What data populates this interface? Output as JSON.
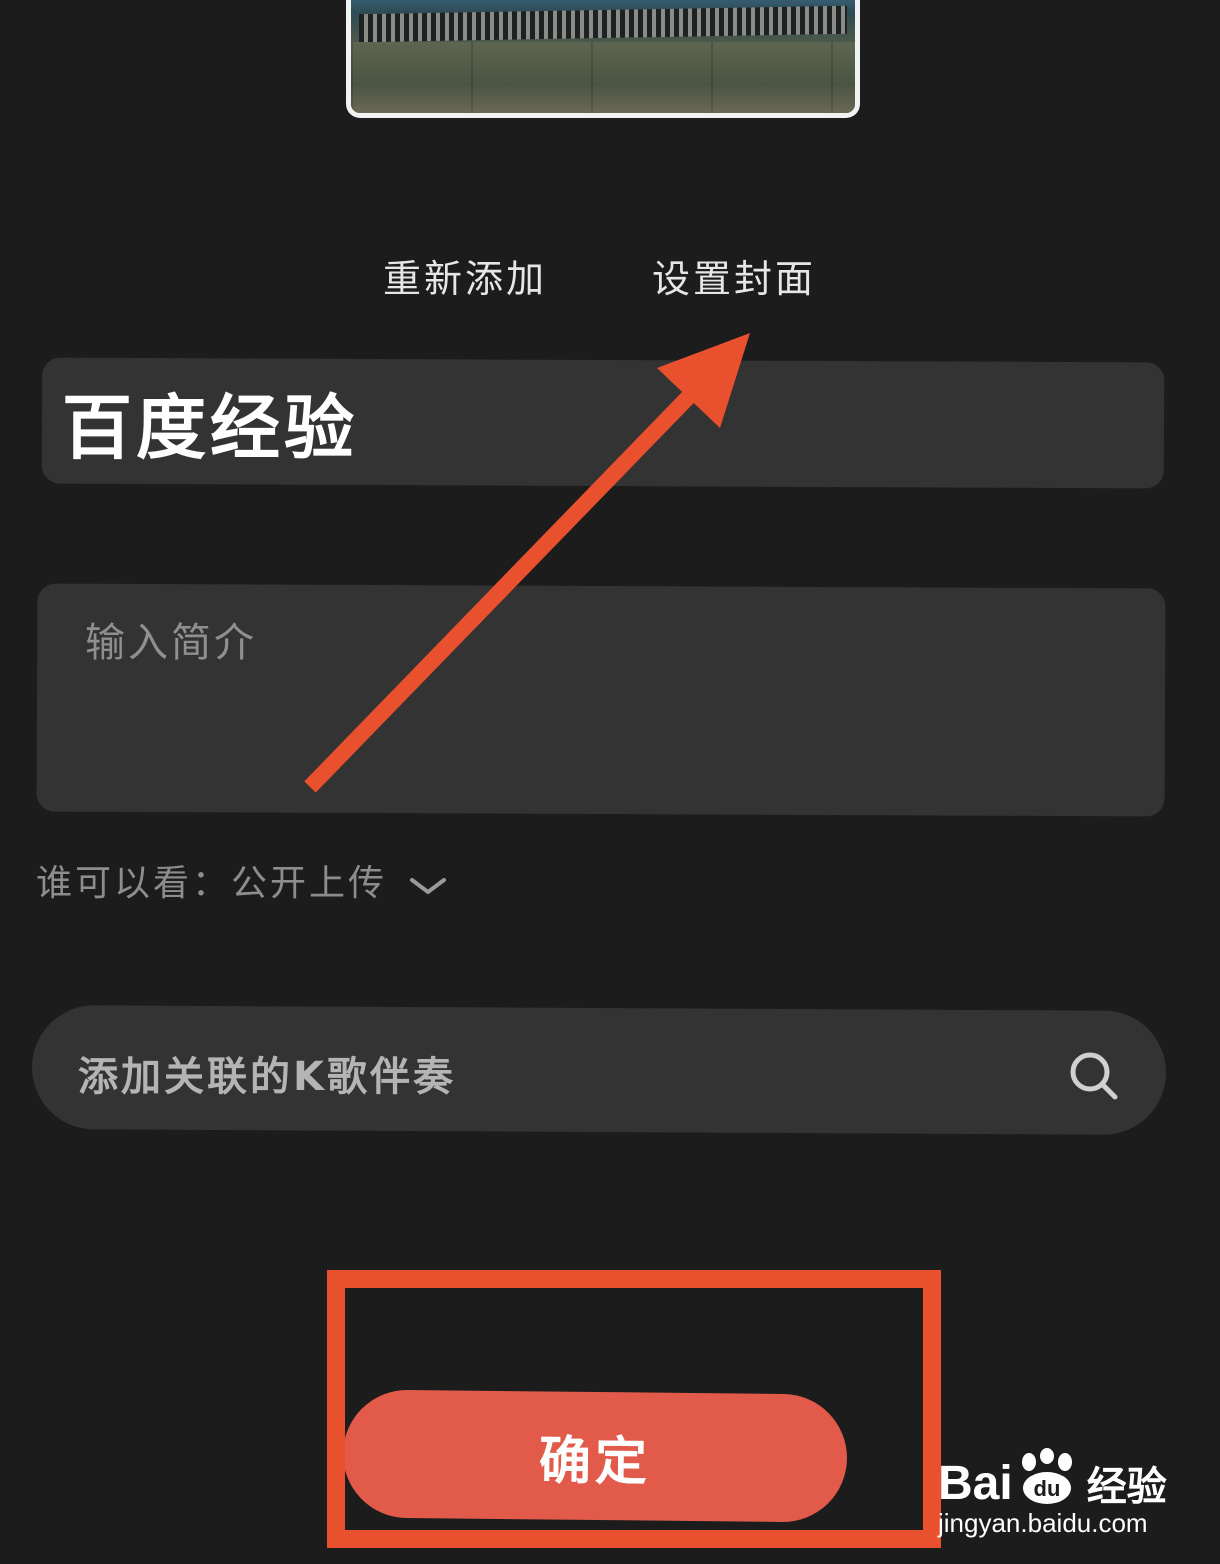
{
  "video": {
    "thumbnail_icon": "video-cover-thumbnail"
  },
  "actions": {
    "re_add": "重新添加",
    "set_cover": "设置封面"
  },
  "title_field": {
    "value": "百度经验"
  },
  "intro_field": {
    "placeholder": "输入简介"
  },
  "visibility": {
    "label": "谁可以看：",
    "value": "公开上传",
    "icon": "chevron-down-icon"
  },
  "accompaniment_search": {
    "placeholder": "添加关联的K歌伴奏",
    "icon": "search-icon"
  },
  "confirm_button": {
    "label": "确定"
  },
  "annotations": {
    "arrow_color": "#e8502e",
    "highlight_box_color": "#e8502e"
  },
  "watermark": {
    "logo_prefix": "Bai",
    "logo_suffix": "经验",
    "url": "jingyan.baidu.com"
  },
  "colors": {
    "background": "#1c1c1c",
    "field": "#333333",
    "confirm": "#e15a4a"
  }
}
